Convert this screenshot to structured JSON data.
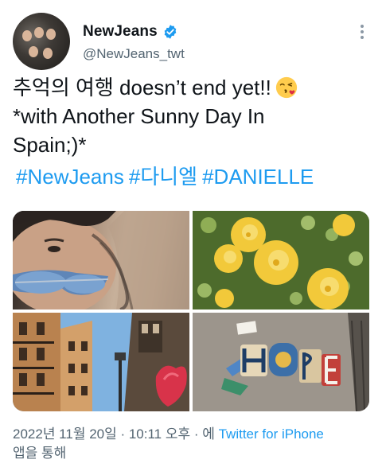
{
  "profile": {
    "display_name": "NewJeans",
    "handle": "@NewJeans_twt",
    "verified": true
  },
  "tweet": {
    "line1": "추억의 여행 doesn’t end yet!!",
    "line1_emoji": "kissing-face-with-heart-emoji",
    "line2": "*with Another Sunny Day In",
    "line3": "Spain;)*",
    "hashtags": [
      "#NewJeans",
      "#다니엘",
      "#DANIELLE"
    ]
  },
  "media": {
    "count": 4,
    "images": [
      "selfie-with-sunglasses-photo",
      "yellow-flowers-photo",
      "street-buildings-photo",
      "hope-street-art-photo"
    ]
  },
  "footer": {
    "timestamp": "2022년 11월 20일 · 10:11 오후 · 에 ",
    "source": "Twitter for iPhone",
    "suffix": "앱을 통해"
  },
  "colors": {
    "link": "#1d9bf0",
    "secondary_text": "#536471",
    "verified_badge": "#1d9bf0"
  }
}
